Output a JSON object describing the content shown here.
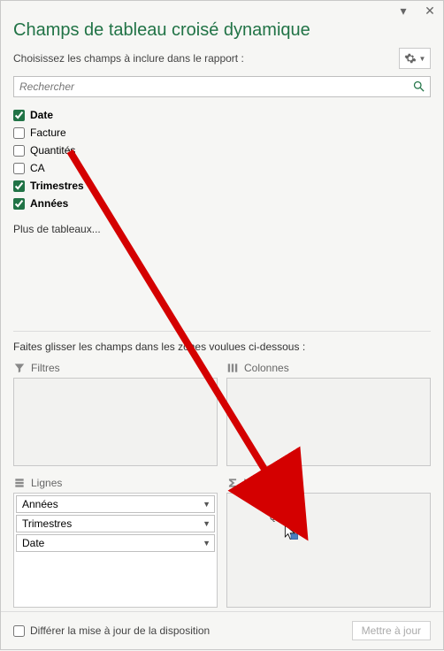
{
  "title": "Champs de tableau croisé dynamique",
  "subhint": "Choisissez les champs à inclure dans le rapport :",
  "search": {
    "placeholder": "Rechercher"
  },
  "fields": [
    {
      "label": "Date",
      "checked": true,
      "bold": true
    },
    {
      "label": "Facture",
      "checked": false,
      "bold": false
    },
    {
      "label": "Quantités",
      "checked": false,
      "bold": false
    },
    {
      "label": "CA",
      "checked": false,
      "bold": false
    },
    {
      "label": "Trimestres",
      "checked": true,
      "bold": true
    },
    {
      "label": "Années",
      "checked": true,
      "bold": true
    }
  ],
  "more_tables": "Plus de tableaux...",
  "drag_hint": "Faites glisser les champs dans les zones voulues ci-dessous :",
  "zones": {
    "filters": {
      "label": "Filtres"
    },
    "columns": {
      "label": "Colonnes"
    },
    "rows": {
      "label": "Lignes",
      "items": [
        "Années",
        "Trimestres",
        "Date"
      ]
    },
    "values": {
      "label": "Valeurs",
      "drag_ghost": "Quantités"
    }
  },
  "footer": {
    "defer": "Différer la mise à jour de la disposition",
    "update": "Mettre à jour"
  }
}
